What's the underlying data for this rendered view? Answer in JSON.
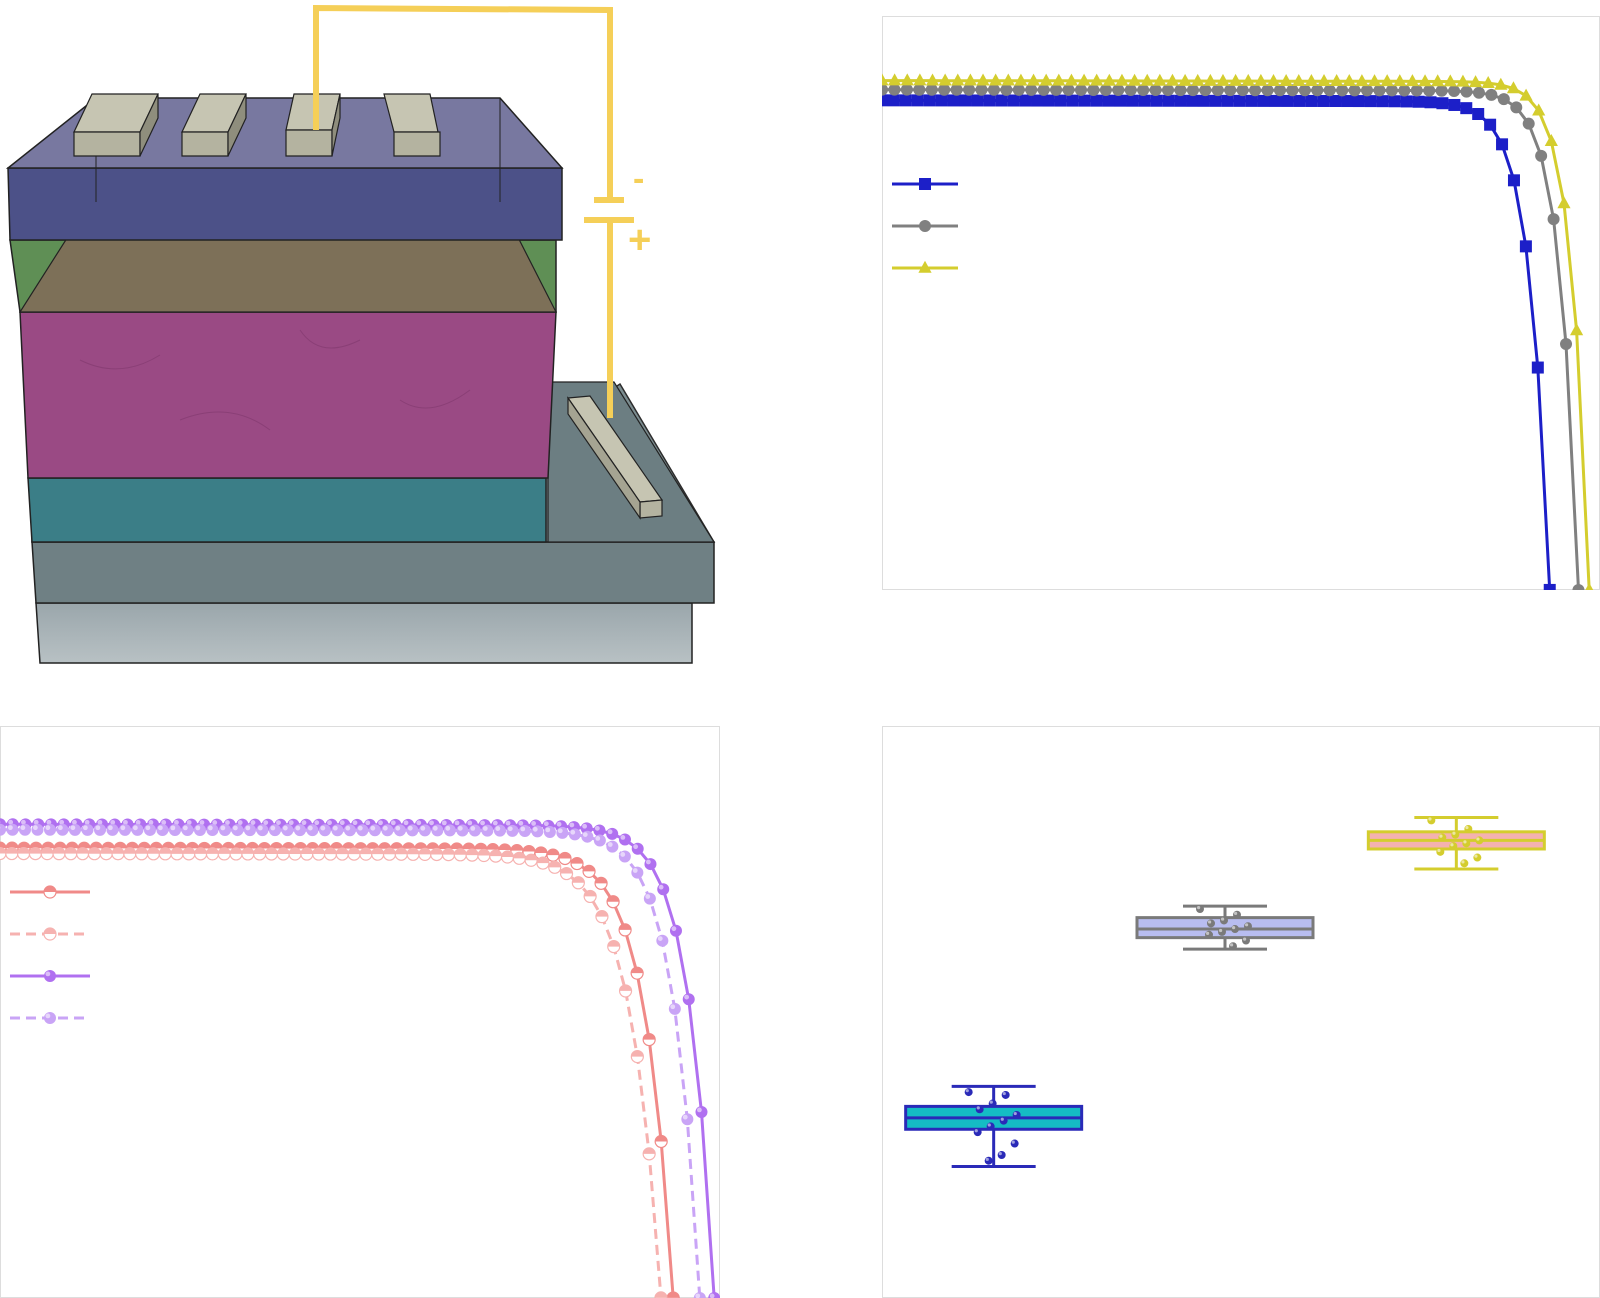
{
  "device": {
    "battery": {
      "minus": "-",
      "plus": "+"
    },
    "colors": {
      "top_layer": "#4c5188",
      "green_layer": "#5f8f55",
      "brown_layer": "#7d7058",
      "absorber": "#9a4a84",
      "cyan_layer": "#3b7e87",
      "substrate": "#6f8084",
      "glass": "#a9b4b8",
      "electrode": "#b4b3a0",
      "wire": "#f5cf58"
    },
    "electrode_icon": "electrode-bar-icon"
  },
  "chart_data": [
    {
      "type": "line",
      "panel": "jv-curves-top-right",
      "title": "",
      "xlabel": "",
      "ylabel": "",
      "xlim": [
        0,
        1
      ],
      "ylim": [
        0,
        1
      ],
      "grid": false,
      "legend": "upper-left",
      "series": [
        {
          "color": "#1c1fc8",
          "marker": "square",
          "style": "solid",
          "jsc": 0.915,
          "voc": 0.93,
          "shape": 34
        },
        {
          "color": "#808080",
          "marker": "circle",
          "style": "solid",
          "jsc": 0.935,
          "voc": 0.97,
          "shape": 38
        },
        {
          "color": "#d4cd2e",
          "marker": "triangle",
          "style": "solid",
          "jsc": 0.952,
          "voc": 0.985,
          "shape": 40
        }
      ]
    },
    {
      "type": "line",
      "panel": "jv-curves-bottom-left",
      "title": "",
      "xlabel": "",
      "ylabel": "",
      "xlim": [
        0,
        1
      ],
      "ylim": [
        0,
        1
      ],
      "grid": false,
      "legend": "upper-left",
      "series": [
        {
          "color": "#f08a88",
          "marker": "half-circle",
          "style": "solid",
          "jsc": 0.828,
          "voc": 0.935,
          "shape": 24
        },
        {
          "color": "#f6b2b0",
          "marker": "half-circle",
          "style": "dashed",
          "jsc": 0.818,
          "voc": 0.918,
          "shape": 22
        },
        {
          "color": "#b070f0",
          "marker": "sphere",
          "style": "solid",
          "jsc": 0.872,
          "voc": 0.992,
          "shape": 28
        },
        {
          "color": "#c9a4f6",
          "marker": "sphere",
          "style": "dashed",
          "jsc": 0.862,
          "voc": 0.972,
          "shape": 27
        }
      ]
    },
    {
      "type": "box",
      "panel": "box-plot-bottom-right",
      "title": "",
      "xlabel": "",
      "ylabel": "",
      "xlim": [
        0,
        3
      ],
      "ylim": [
        0,
        1
      ],
      "grid": false,
      "boxes": [
        {
          "x": 0.5,
          "edge": "#2a2ab8",
          "fill": "#15bcc4",
          "min": 0.23,
          "q1": 0.295,
          "median": 0.315,
          "q3": 0.335,
          "max": 0.37,
          "points": [
            0.36,
            0.355,
            0.34,
            0.33,
            0.32,
            0.31,
            0.3,
            0.29,
            0.27,
            0.25,
            0.24
          ]
        },
        {
          "x": 1.5,
          "edge": "#7a7a7a",
          "fill": "#b8bdf0",
          "min": 0.61,
          "q1": 0.63,
          "median": 0.645,
          "q3": 0.665,
          "max": 0.685,
          "points": [
            0.68,
            0.67,
            0.66,
            0.655,
            0.65,
            0.645,
            0.64,
            0.635,
            0.625,
            0.615
          ]
        },
        {
          "x": 2.5,
          "edge": "#d4cd2e",
          "fill": "#f4b2b0",
          "min": 0.75,
          "q1": 0.785,
          "median": 0.8,
          "q3": 0.815,
          "max": 0.84,
          "points": [
            0.835,
            0.82,
            0.81,
            0.805,
            0.8,
            0.795,
            0.79,
            0.78,
            0.77,
            0.76
          ]
        }
      ]
    }
  ]
}
